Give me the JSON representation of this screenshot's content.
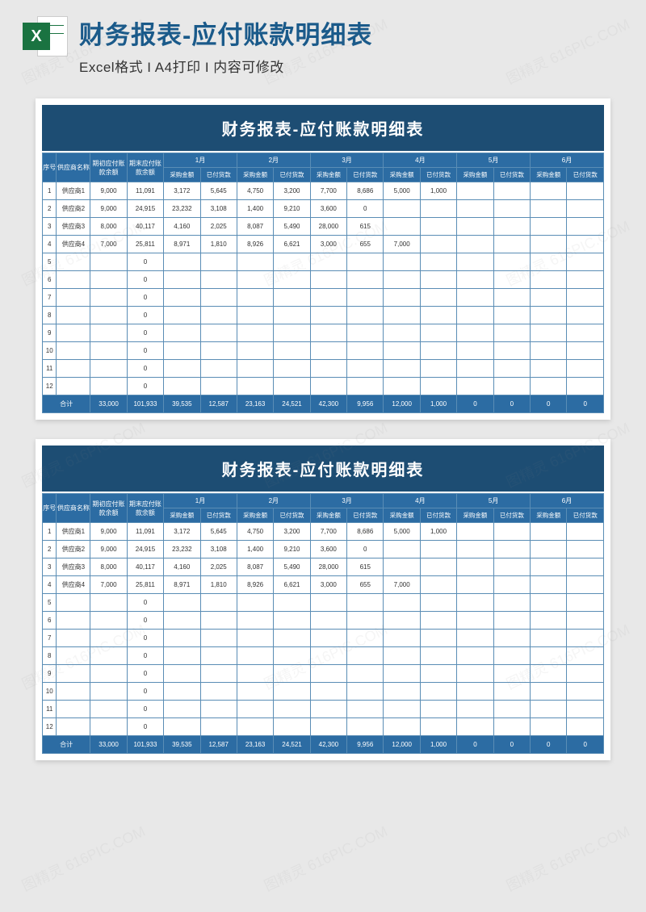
{
  "header": {
    "title": "财务报表-应付账款明细表",
    "subtitle": "Excel格式 I A4打印 I 内容可修改"
  },
  "watermark": "图精灵 616PIC.COM",
  "table": {
    "title": "财务报表-应付账款明细表",
    "head": {
      "seq": "序号",
      "supplier": "供应商名称",
      "open_bal": "期初应付账款余额",
      "close_bal": "期末应付账款余额",
      "months": [
        "1月",
        "2月",
        "3月",
        "4月",
        "5月",
        "6月"
      ],
      "purchase": "采购金额",
      "paid": "已付货款"
    },
    "rows": [
      {
        "idx": "1",
        "sup": "供应商1",
        "open": "9,000",
        "close": "11,091",
        "m": [
          "3,172",
          "5,645",
          "4,750",
          "3,200",
          "7,700",
          "8,686",
          "5,000",
          "1,000",
          "",
          "",
          "",
          ""
        ]
      },
      {
        "idx": "2",
        "sup": "供应商2",
        "open": "9,000",
        "close": "24,915",
        "m": [
          "23,232",
          "3,108",
          "1,400",
          "9,210",
          "3,600",
          "0",
          "",
          "",
          "",
          "",
          "",
          ""
        ]
      },
      {
        "idx": "3",
        "sup": "供应商3",
        "open": "8,000",
        "close": "40,117",
        "m": [
          "4,160",
          "2,025",
          "8,087",
          "5,490",
          "28,000",
          "615",
          "",
          "",
          "",
          "",
          "",
          ""
        ]
      },
      {
        "idx": "4",
        "sup": "供应商4",
        "open": "7,000",
        "close": "25,811",
        "m": [
          "8,971",
          "1,810",
          "8,926",
          "6,621",
          "3,000",
          "655",
          "7,000",
          "",
          "",
          "",
          "",
          ""
        ]
      },
      {
        "idx": "5",
        "sup": "",
        "open": "",
        "close": "0",
        "m": [
          "",
          "",
          "",
          "",
          "",
          "",
          "",
          "",
          "",
          "",
          "",
          ""
        ]
      },
      {
        "idx": "6",
        "sup": "",
        "open": "",
        "close": "0",
        "m": [
          "",
          "",
          "",
          "",
          "",
          "",
          "",
          "",
          "",
          "",
          "",
          ""
        ]
      },
      {
        "idx": "7",
        "sup": "",
        "open": "",
        "close": "0",
        "m": [
          "",
          "",
          "",
          "",
          "",
          "",
          "",
          "",
          "",
          "",
          "",
          ""
        ]
      },
      {
        "idx": "8",
        "sup": "",
        "open": "",
        "close": "0",
        "m": [
          "",
          "",
          "",
          "",
          "",
          "",
          "",
          "",
          "",
          "",
          "",
          ""
        ]
      },
      {
        "idx": "9",
        "sup": "",
        "open": "",
        "close": "0",
        "m": [
          "",
          "",
          "",
          "",
          "",
          "",
          "",
          "",
          "",
          "",
          "",
          ""
        ]
      },
      {
        "idx": "10",
        "sup": "",
        "open": "",
        "close": "0",
        "m": [
          "",
          "",
          "",
          "",
          "",
          "",
          "",
          "",
          "",
          "",
          "",
          ""
        ]
      },
      {
        "idx": "11",
        "sup": "",
        "open": "",
        "close": "0",
        "m": [
          "",
          "",
          "",
          "",
          "",
          "",
          "",
          "",
          "",
          "",
          "",
          ""
        ]
      },
      {
        "idx": "12",
        "sup": "",
        "open": "",
        "close": "0",
        "m": [
          "",
          "",
          "",
          "",
          "",
          "",
          "",
          "",
          "",
          "",
          "",
          ""
        ]
      }
    ],
    "totals": {
      "label": "合计",
      "open": "33,000",
      "close": "101,933",
      "m": [
        "39,535",
        "12,587",
        "23,163",
        "24,521",
        "42,300",
        "9,956",
        "12,000",
        "1,000",
        "0",
        "0",
        "0",
        "0"
      ]
    }
  }
}
